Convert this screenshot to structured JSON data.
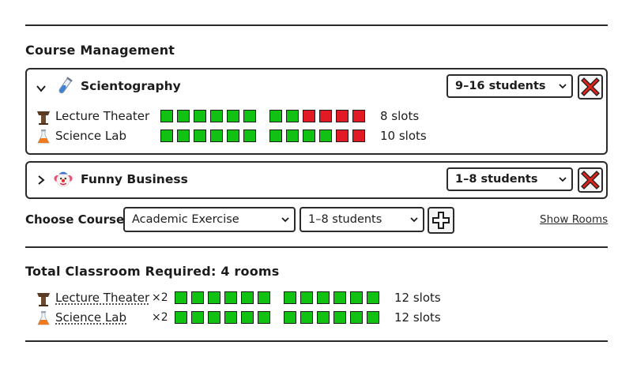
{
  "section_title": "Course Management",
  "courses": [
    {
      "name": "Scientography",
      "expanded": true,
      "students": "9–16 students",
      "rooms": [
        {
          "name": "Lecture Theater",
          "slots_label": "8 slots",
          "squares": [
            "g",
            "g",
            "g",
            "g",
            "g",
            "g",
            "g",
            "g",
            "r",
            "r",
            "r",
            "r"
          ]
        },
        {
          "name": "Science Lab",
          "slots_label": "10 slots",
          "squares": [
            "g",
            "g",
            "g",
            "g",
            "g",
            "g",
            "g",
            "g",
            "g",
            "g",
            "r",
            "r"
          ]
        }
      ]
    },
    {
      "name": "Funny Business",
      "expanded": false,
      "students": "1–8 students",
      "rooms": []
    }
  ],
  "add_course": {
    "label": "Choose Course:",
    "course_value": "Academic Exercise",
    "students_value": "1–8 students"
  },
  "show_rooms_link": "Show Rooms",
  "total_title": "Total Classroom Required: 4 rooms",
  "totals": [
    {
      "name": "Lecture Theater",
      "multiplier": "×2",
      "slots_label": "12 slots",
      "squares": [
        "g",
        "g",
        "g",
        "g",
        "g",
        "g",
        "g",
        "g",
        "g",
        "g",
        "g",
        "g"
      ]
    },
    {
      "name": "Science Lab",
      "multiplier": "×2",
      "slots_label": "12 slots",
      "squares": [
        "g",
        "g",
        "g",
        "g",
        "g",
        "g",
        "g",
        "g",
        "g",
        "g",
        "g",
        "g"
      ]
    }
  ],
  "colors": {
    "slot_free": "#12c212",
    "slot_full": "#e21a26",
    "x_red": "#d9241c"
  },
  "icons": {
    "expand": "chevron-down-icon",
    "collapse": "chevron-right-icon",
    "scientography": "test-tube-icon",
    "funny_business": "clown-face-icon",
    "lecture_theater": "lectern-icon",
    "science_lab": "flask-icon",
    "remove": "close-icon",
    "add": "plus-icon",
    "dropdown": "chevron-down-icon"
  }
}
